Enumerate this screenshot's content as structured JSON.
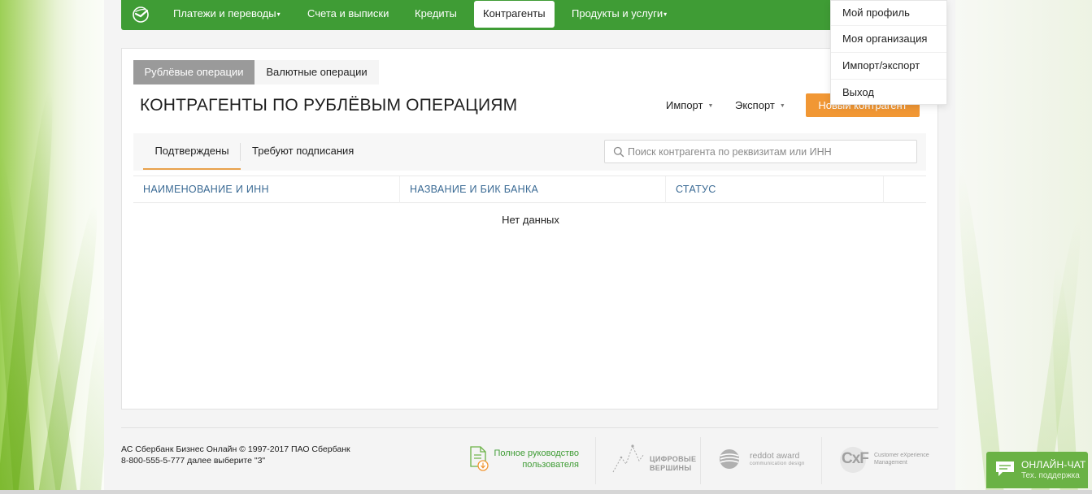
{
  "nav": {
    "items": [
      {
        "label": "Платежи и переводы",
        "has_caret": true
      },
      {
        "label": "Счета и выписки",
        "has_caret": false
      },
      {
        "label": "Кредиты",
        "has_caret": false
      },
      {
        "label": "Контрагенты",
        "has_caret": false,
        "active": true
      },
      {
        "label": "Продукты и услуги",
        "has_caret": true
      }
    ],
    "caret": "▾",
    "logo_icon": "sberbank-logo-icon",
    "color": "#3f9c35"
  },
  "user_menu": {
    "items": [
      "Мой профиль",
      "Моя организация",
      "Импорт/экспорт",
      "Выход"
    ]
  },
  "operations_tabs": {
    "active": "Рублёвые операции",
    "inactive": "Валютные операции"
  },
  "page": {
    "title": "КОНТРАГЕНТЫ ПО РУБЛЁВЫМ ОПЕРАЦИЯМ",
    "import_label": "Импорт",
    "export_label": "Экспорт",
    "dropdown_marker": "▼",
    "new_button": "Новый контрагент",
    "accent": "#f19734"
  },
  "filter": {
    "tab_confirmed": "Подтверждены",
    "tab_pending": "Требуют подписания",
    "search_placeholder": "Поиск контрагента по реквизитам или ИНН"
  },
  "table": {
    "columns": [
      "НАИМЕНОВАНИЕ И ИНН",
      "НАЗВАНИЕ И БИК БАНКА",
      "СТАТУС"
    ],
    "empty_text": "Нет данных"
  },
  "footer": {
    "copyright_line1": "АС Сбербанк Бизнес Онлайн © 1997-2017 ПАО Сбербанк",
    "copyright_line2": "8-800-555-5-777 далее выберите \"3\"",
    "guide_line1": "Полное руководство",
    "guide_line2": "пользователя",
    "award1_line1": "ЦИФРОВЫЕ",
    "award1_line2": "ВЕРШИНЫ",
    "award2_title": "reddot award",
    "award2_sub": "communication design",
    "award3_logo": "CxF",
    "award3_line1": "Customer eXperience",
    "award3_line2": "Management"
  },
  "chat": {
    "title": "ОНЛАЙН-ЧАТ",
    "subtitle": "Тех. поддержка",
    "color": "#6ab245"
  }
}
